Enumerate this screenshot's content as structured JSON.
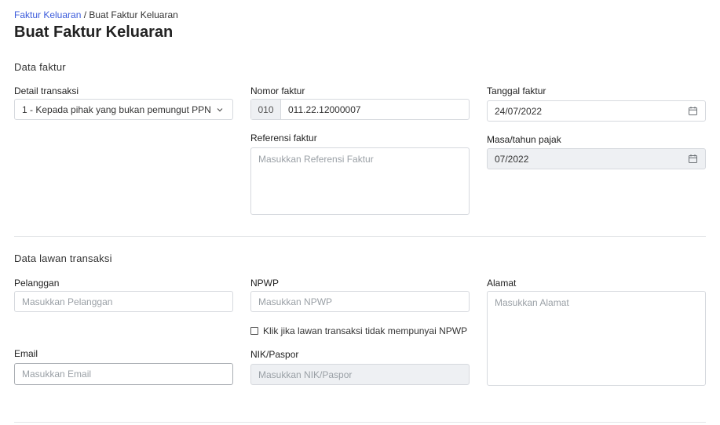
{
  "breadcrumb": {
    "parent": "Faktur Keluaran",
    "separator": " / ",
    "current": "Buat Faktur Keluaran"
  },
  "page_title": "Buat Faktur Keluaran",
  "section_faktur": {
    "title": "Data faktur",
    "detail_transaksi": {
      "label": "Detail transaksi",
      "value": "1 - Kepada pihak yang bukan pemungut PPN"
    },
    "nomor_faktur": {
      "label": "Nomor faktur",
      "prefix": "010",
      "value": "011.22.12000007"
    },
    "tanggal_faktur": {
      "label": "Tanggal faktur",
      "value": "24/07/2022"
    },
    "referensi_faktur": {
      "label": "Referensi faktur",
      "placeholder": "Masukkan Referensi Faktur"
    },
    "masa_tahun_pajak": {
      "label": "Masa/tahun pajak",
      "value": "07/2022"
    }
  },
  "section_lawan": {
    "title": "Data lawan transaksi",
    "pelanggan": {
      "label": "Pelanggan",
      "placeholder": "Masukkan Pelanggan"
    },
    "npwp": {
      "label": "NPWP",
      "placeholder": "Masukkan NPWP"
    },
    "no_npwp_check": {
      "label": "Klik jika lawan transaksi tidak mempunyai NPWP",
      "checked": false
    },
    "alamat": {
      "label": "Alamat",
      "placeholder": "Masukkan Alamat"
    },
    "email": {
      "label": "Email",
      "placeholder": "Masukkan Email"
    },
    "nik_paspor": {
      "label": "NIK/Paspor",
      "placeholder": "Masukkan NIK/Paspor"
    }
  },
  "icons": {
    "dropdown": "chevron-down-icon",
    "calendar": "calendar-icon"
  }
}
